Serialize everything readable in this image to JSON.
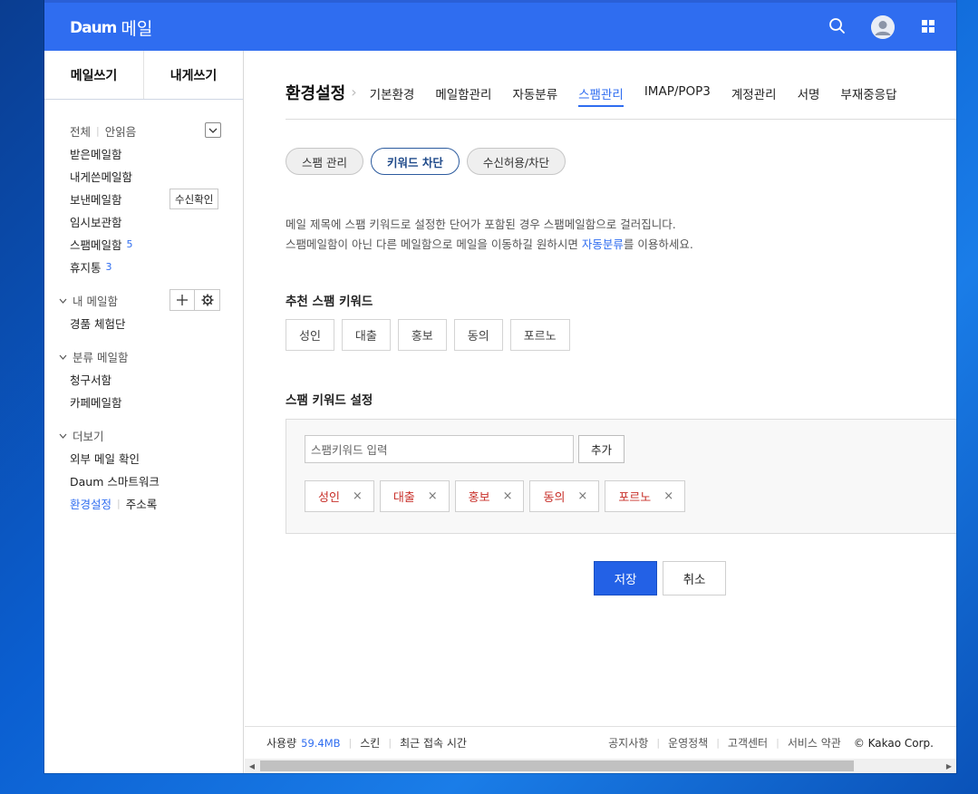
{
  "header": {
    "logo_daum": "Daum",
    "logo_mail": "메일"
  },
  "sidebar": {
    "compose": "메일쓰기",
    "self_write": "내게쓰기",
    "filter_all": "전체",
    "filter_unread": "안읽음",
    "inbox": "받은메일함",
    "self_box": "내게쓴메일함",
    "sent": "보낸메일함",
    "read_receipt": "수신확인",
    "drafts": "임시보관함",
    "spam": "스팸메일함",
    "spam_count": "5",
    "trash": "휴지통",
    "trash_count": "3",
    "my_mailbox": "내 메일함",
    "my_item": "경품 체험단",
    "category": "분류 메일함",
    "cat_bills": "청구서함",
    "cat_cafe": "카페메일함",
    "more": "더보기",
    "external": "외부 메일 확인",
    "smartwork": "Daum 스마트워크",
    "settings": "환경설정",
    "contacts": "주소록"
  },
  "tabs": {
    "title": "환경설정",
    "items": [
      "기본환경",
      "메일함관리",
      "자동분류",
      "스팸관리",
      "IMAP/POP3",
      "계정관리",
      "서명",
      "부재중응답"
    ]
  },
  "pills": [
    "스팸 관리",
    "키워드 차단",
    "수신허용/차단"
  ],
  "desc": {
    "line1": "메일 제목에 스팸 키워드로 설정한 단어가 포함된 경우 스팸메일함으로 걸러집니다.",
    "line2_pre": "스팸메일함이 아닌 다른 메일함으로 메일을 이동하길 원하시면 ",
    "line2_link": "자동분류",
    "line2_post": "를 이용하세요."
  },
  "recommend": {
    "title": "추천 스팸 키워드",
    "items": [
      "성인",
      "대출",
      "홍보",
      "동의",
      "포르노"
    ]
  },
  "keyword_settings": {
    "title": "스팸 키워드 설정",
    "input_placeholder": "스팸키워드 입력",
    "add_label": "추가",
    "chips": [
      "성인",
      "대출",
      "홍보",
      "동의",
      "포르노"
    ]
  },
  "actions": {
    "save": "저장",
    "cancel": "취소"
  },
  "footer": {
    "usage_label": "사용량",
    "usage_value": "59.4MB",
    "skin": "스킨",
    "recent": "최근 접속 시간",
    "notice": "공지사항",
    "policy": "운영정책",
    "support": "고객센터",
    "terms": "서비스 약관",
    "copyright": "© Kakao Corp."
  },
  "colors": {
    "brand": "#2f6df0",
    "keyword_red": "#c8302a"
  }
}
